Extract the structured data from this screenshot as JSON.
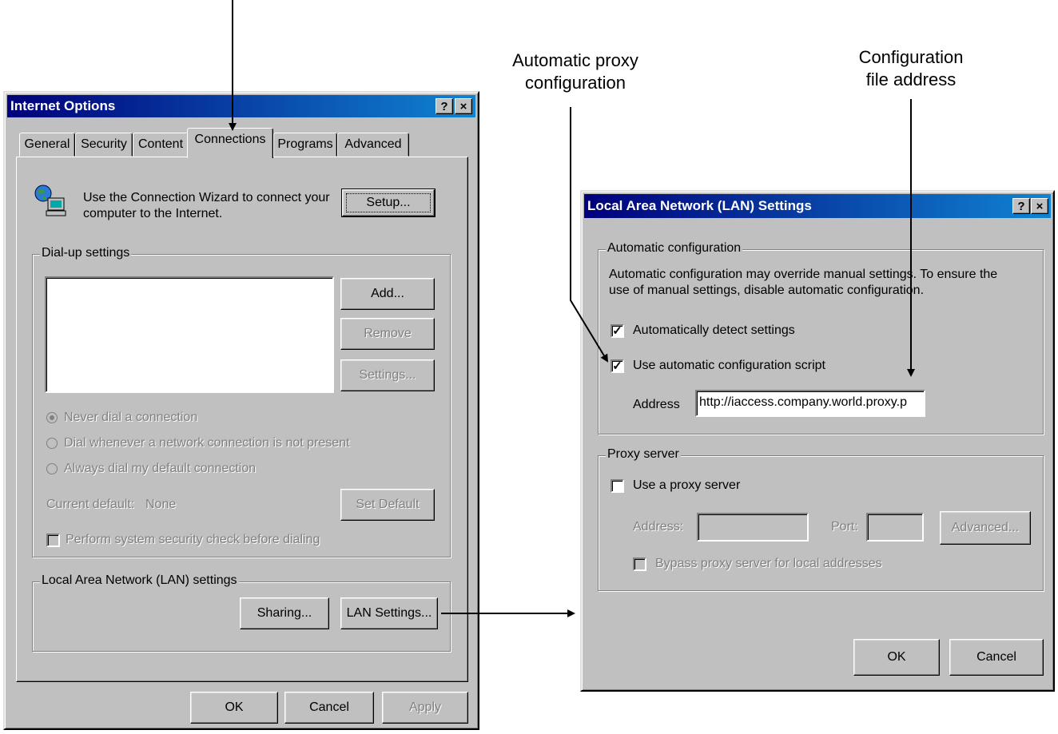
{
  "annotations": {
    "proxy_config_line1": "Automatic proxy",
    "proxy_config_line2": "configuration",
    "file_address_line1": "Configuration",
    "file_address_line2": "file address"
  },
  "internet_options": {
    "title": "Internet Options",
    "help_btn": "?",
    "close_btn": "×",
    "tabs": [
      "General",
      "Security",
      "Content",
      "Connections",
      "Programs",
      "Advanced"
    ],
    "active_tab": "Connections",
    "wizard_text_1": "Use the Connection Wizard to connect your",
    "wizard_text_2": "computer to the Internet.",
    "setup_button": "Setup...",
    "dialup_group": "Dial-up settings",
    "add_button": "Add...",
    "remove_button": "Remove",
    "settings_button": "Settings...",
    "radio_never": "Never dial a connection",
    "radio_whenever": "Dial whenever a network connection is not present",
    "radio_always": "Always dial my default connection",
    "current_default_label": "Current default:",
    "current_default_value": "None",
    "set_default_button": "Set Default",
    "security_check": "Perform system security check before dialing",
    "lan_group": "Local Area Network (LAN) settings",
    "sharing_button": "Sharing...",
    "lan_settings_button": "LAN Settings...",
    "ok_button": "OK",
    "cancel_button": "Cancel",
    "apply_button": "Apply"
  },
  "lan_settings": {
    "title": "Local Area Network (LAN) Settings",
    "help_btn": "?",
    "close_btn": "×",
    "auto_group": "Automatic configuration",
    "auto_desc_1": "Automatic configuration may override manual settings.  To ensure the",
    "auto_desc_2": "use of manual settings, disable automatic configuration.",
    "auto_detect": "Automatically detect settings",
    "auto_detect_checked": true,
    "use_script": "Use automatic configuration script",
    "use_script_checked": true,
    "address_label": "Address",
    "address_value": "http://iaccess.company.world.proxy.p",
    "proxy_group": "Proxy server",
    "use_proxy": "Use a proxy server",
    "use_proxy_checked": false,
    "proxy_address_label": "Address:",
    "port_label": "Port:",
    "advanced_button": "Advanced...",
    "bypass": "Bypass proxy server for local addresses",
    "ok_button": "OK",
    "cancel_button": "Cancel"
  }
}
